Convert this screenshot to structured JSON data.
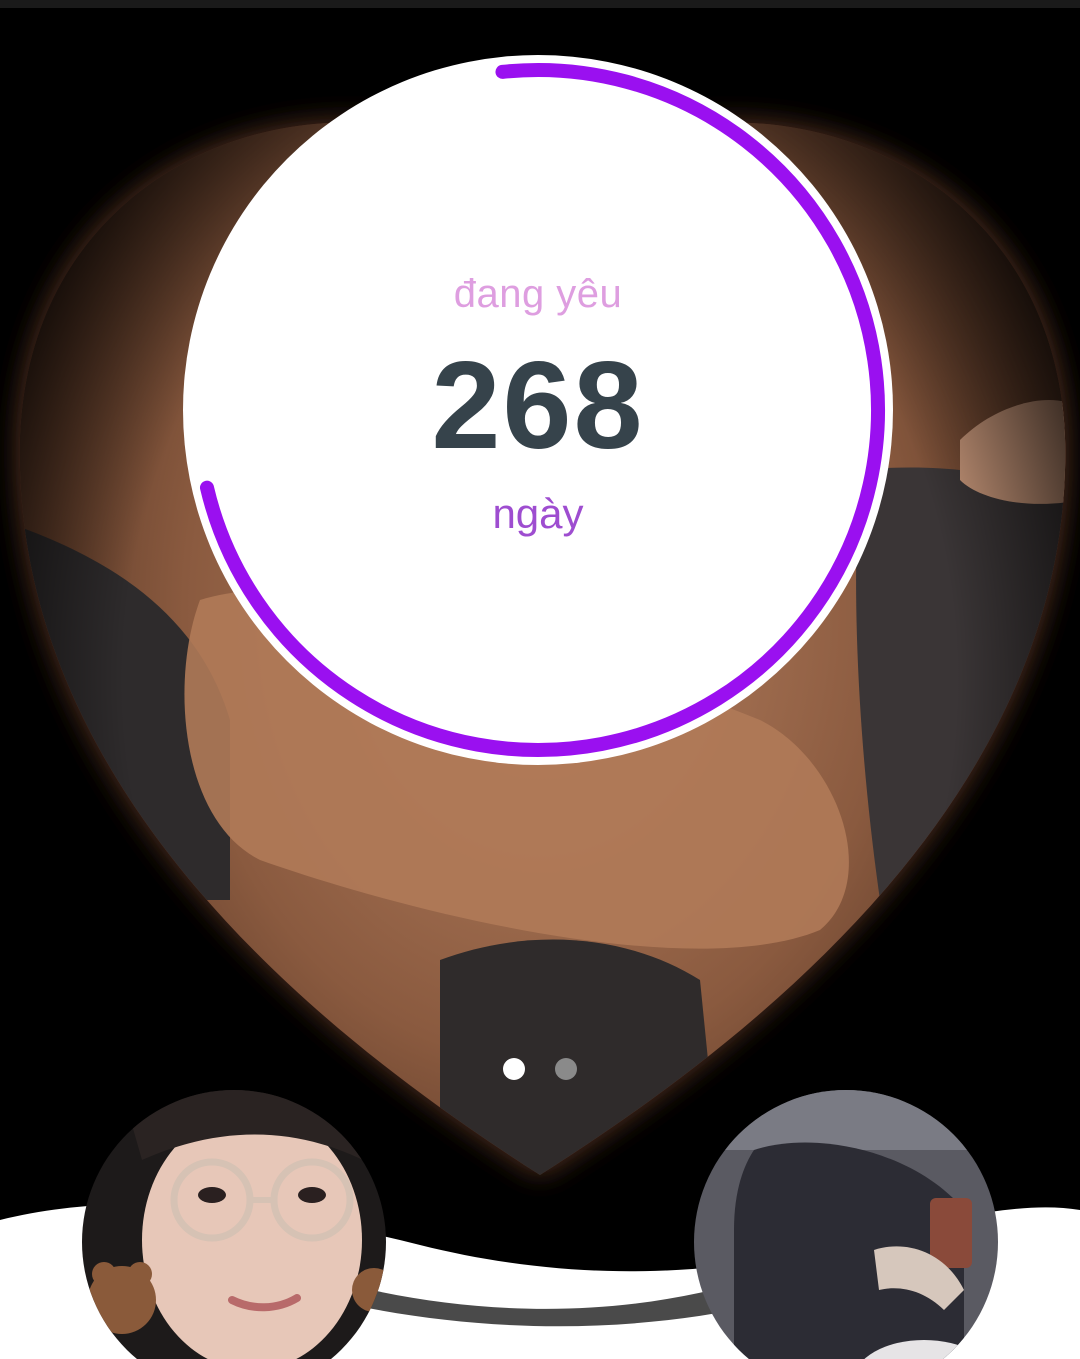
{
  "counter": {
    "label": "đang yêu",
    "days": "268",
    "unit": "ngày",
    "progress": 0.73
  },
  "pager": {
    "total": 2,
    "active": 0
  },
  "colors": {
    "ring": "#9a10f0",
    "label": "#de9ee0",
    "number": "#36434b",
    "unit": "#9e4dd0",
    "dot_active": "#ffffff",
    "dot_inactive": "#8a8a8a"
  },
  "icons": {
    "partner_left": "avatar-girl-glasses-icon",
    "partner_right": "avatar-boy-hoodie-icon"
  }
}
